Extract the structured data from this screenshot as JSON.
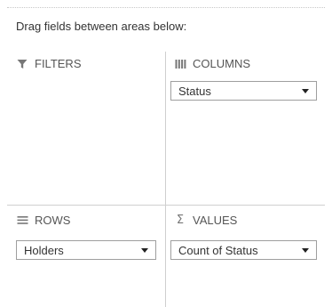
{
  "instruction": "Drag fields between areas below:",
  "areas": {
    "filters": {
      "title": "FILTERS",
      "icon": "filter-icon",
      "fields": []
    },
    "columns": {
      "title": "COLUMNS",
      "icon": "columns-icon",
      "fields": [
        {
          "label": "Status"
        }
      ]
    },
    "rows": {
      "title": "ROWS",
      "icon": "rows-icon",
      "fields": [
        {
          "label": "Holders"
        }
      ]
    },
    "values": {
      "title": "VALUES",
      "icon": "sigma-icon",
      "fields": [
        {
          "label": "Count of Status"
        }
      ]
    }
  },
  "colors": {
    "divider": "#cfcfcf",
    "field_border": "#9e9e9e",
    "text": "#333333"
  }
}
